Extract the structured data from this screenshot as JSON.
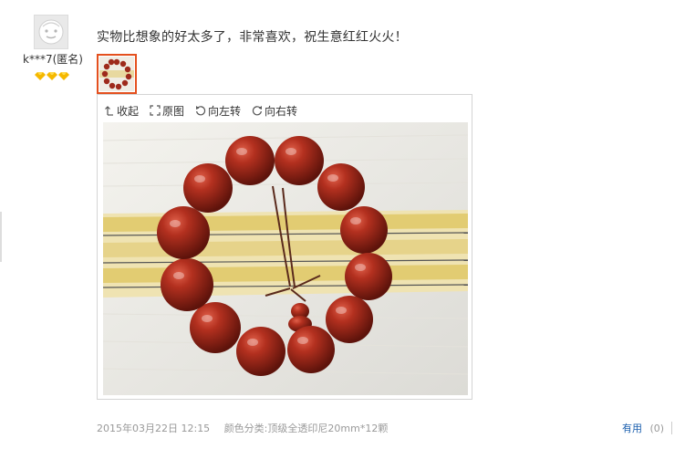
{
  "user": {
    "name": "k***7(匿名)",
    "avatar_icon": "default-avatar-icon",
    "level_icon": "diamond-icon",
    "level_count": 3,
    "level_color": "#f5b800"
  },
  "review": {
    "text": "实物比想象的好太多了，非常喜欢，祝生意红红火火！"
  },
  "viewer": {
    "tools": [
      {
        "label": "收起",
        "icon": "collapse-icon"
      },
      {
        "label": "原图",
        "icon": "fullsize-icon"
      },
      {
        "label": "向左转",
        "icon": "rotate-left-icon"
      },
      {
        "label": "向右转",
        "icon": "rotate-right-icon"
      }
    ]
  },
  "meta": {
    "date": "2015年03月22日 12:15",
    "sku": "颜色分类:顶级全透印尼20mm*12颗"
  },
  "useful": {
    "label": "有用",
    "count": "(0)"
  },
  "colors": {
    "accent_border": "#e4501e",
    "link": "#1b5fae",
    "muted": "#999999"
  }
}
